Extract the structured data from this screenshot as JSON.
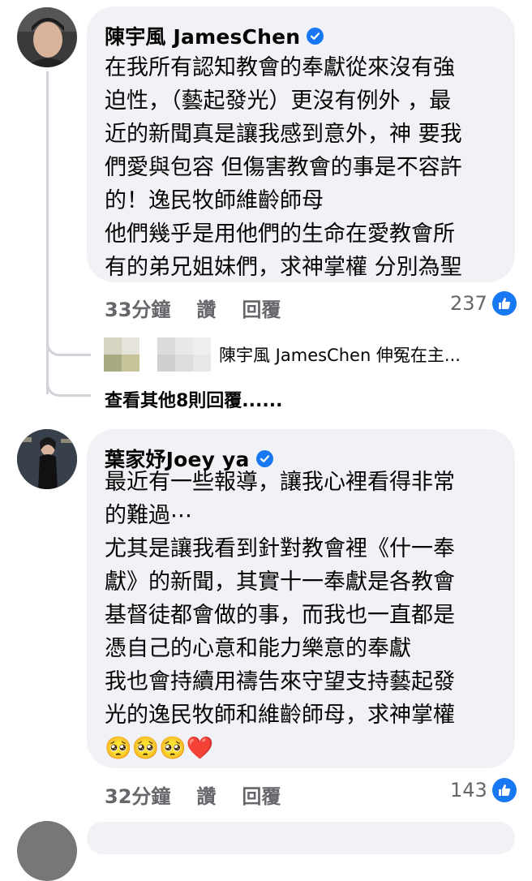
{
  "comments": [
    {
      "author": "陳宇風 JamesChen",
      "verified": true,
      "lines": [
        "在我所有認知教會的奉獻從來沒有強",
        "迫性，（藝起發光）更沒有例外 ，最",
        "近的新聞真是讓我感到意外，神 要我",
        "們愛與包容 但傷害教會的事是不容許",
        "的！逸民牧師維齡師母",
        "他們幾乎是用他們的生命在愛教會所",
        "有的弟兄姐妹們，求神掌權 分別為聖"
      ],
      "time": "33分鐘",
      "like_label": "讚",
      "reply_label": "回覆",
      "reaction_count": "237"
    },
    {
      "author": "葉家妤Joey ya",
      "verified": true,
      "lines": [
        "最近有一些報導，讓我心裡看得非常",
        "的難過⋯",
        "尤其是讓我看到針對教會裡《什一奉",
        "獻》的新聞，其實十一奉獻是各教會",
        "基督徒都會做的事，而我也一直都是",
        "憑自己的心意和能力樂意的奉獻",
        "我也會持續用禱告來守望支持藝起發",
        "光的逸民牧師和維齡師母，求神掌權"
      ],
      "emoji_line": "🥺🥺🥺❤️",
      "time": "32分鐘",
      "like_label": "讚",
      "reply_label": "回覆",
      "reaction_count": "143"
    }
  ],
  "reply_preview": {
    "text": "陳宇風 JamesChen 伸冤在主￼..."
  },
  "more_replies_label": "查看其他8則回覆......",
  "colors": {
    "bubble": "#f0f2f5",
    "brand_blue": "#1877f2",
    "meta_grey": "#65676b",
    "thread_line": "#d0d3d8"
  },
  "icons": {
    "verified": "verified-badge-icon",
    "like": "like-thumb-icon"
  }
}
